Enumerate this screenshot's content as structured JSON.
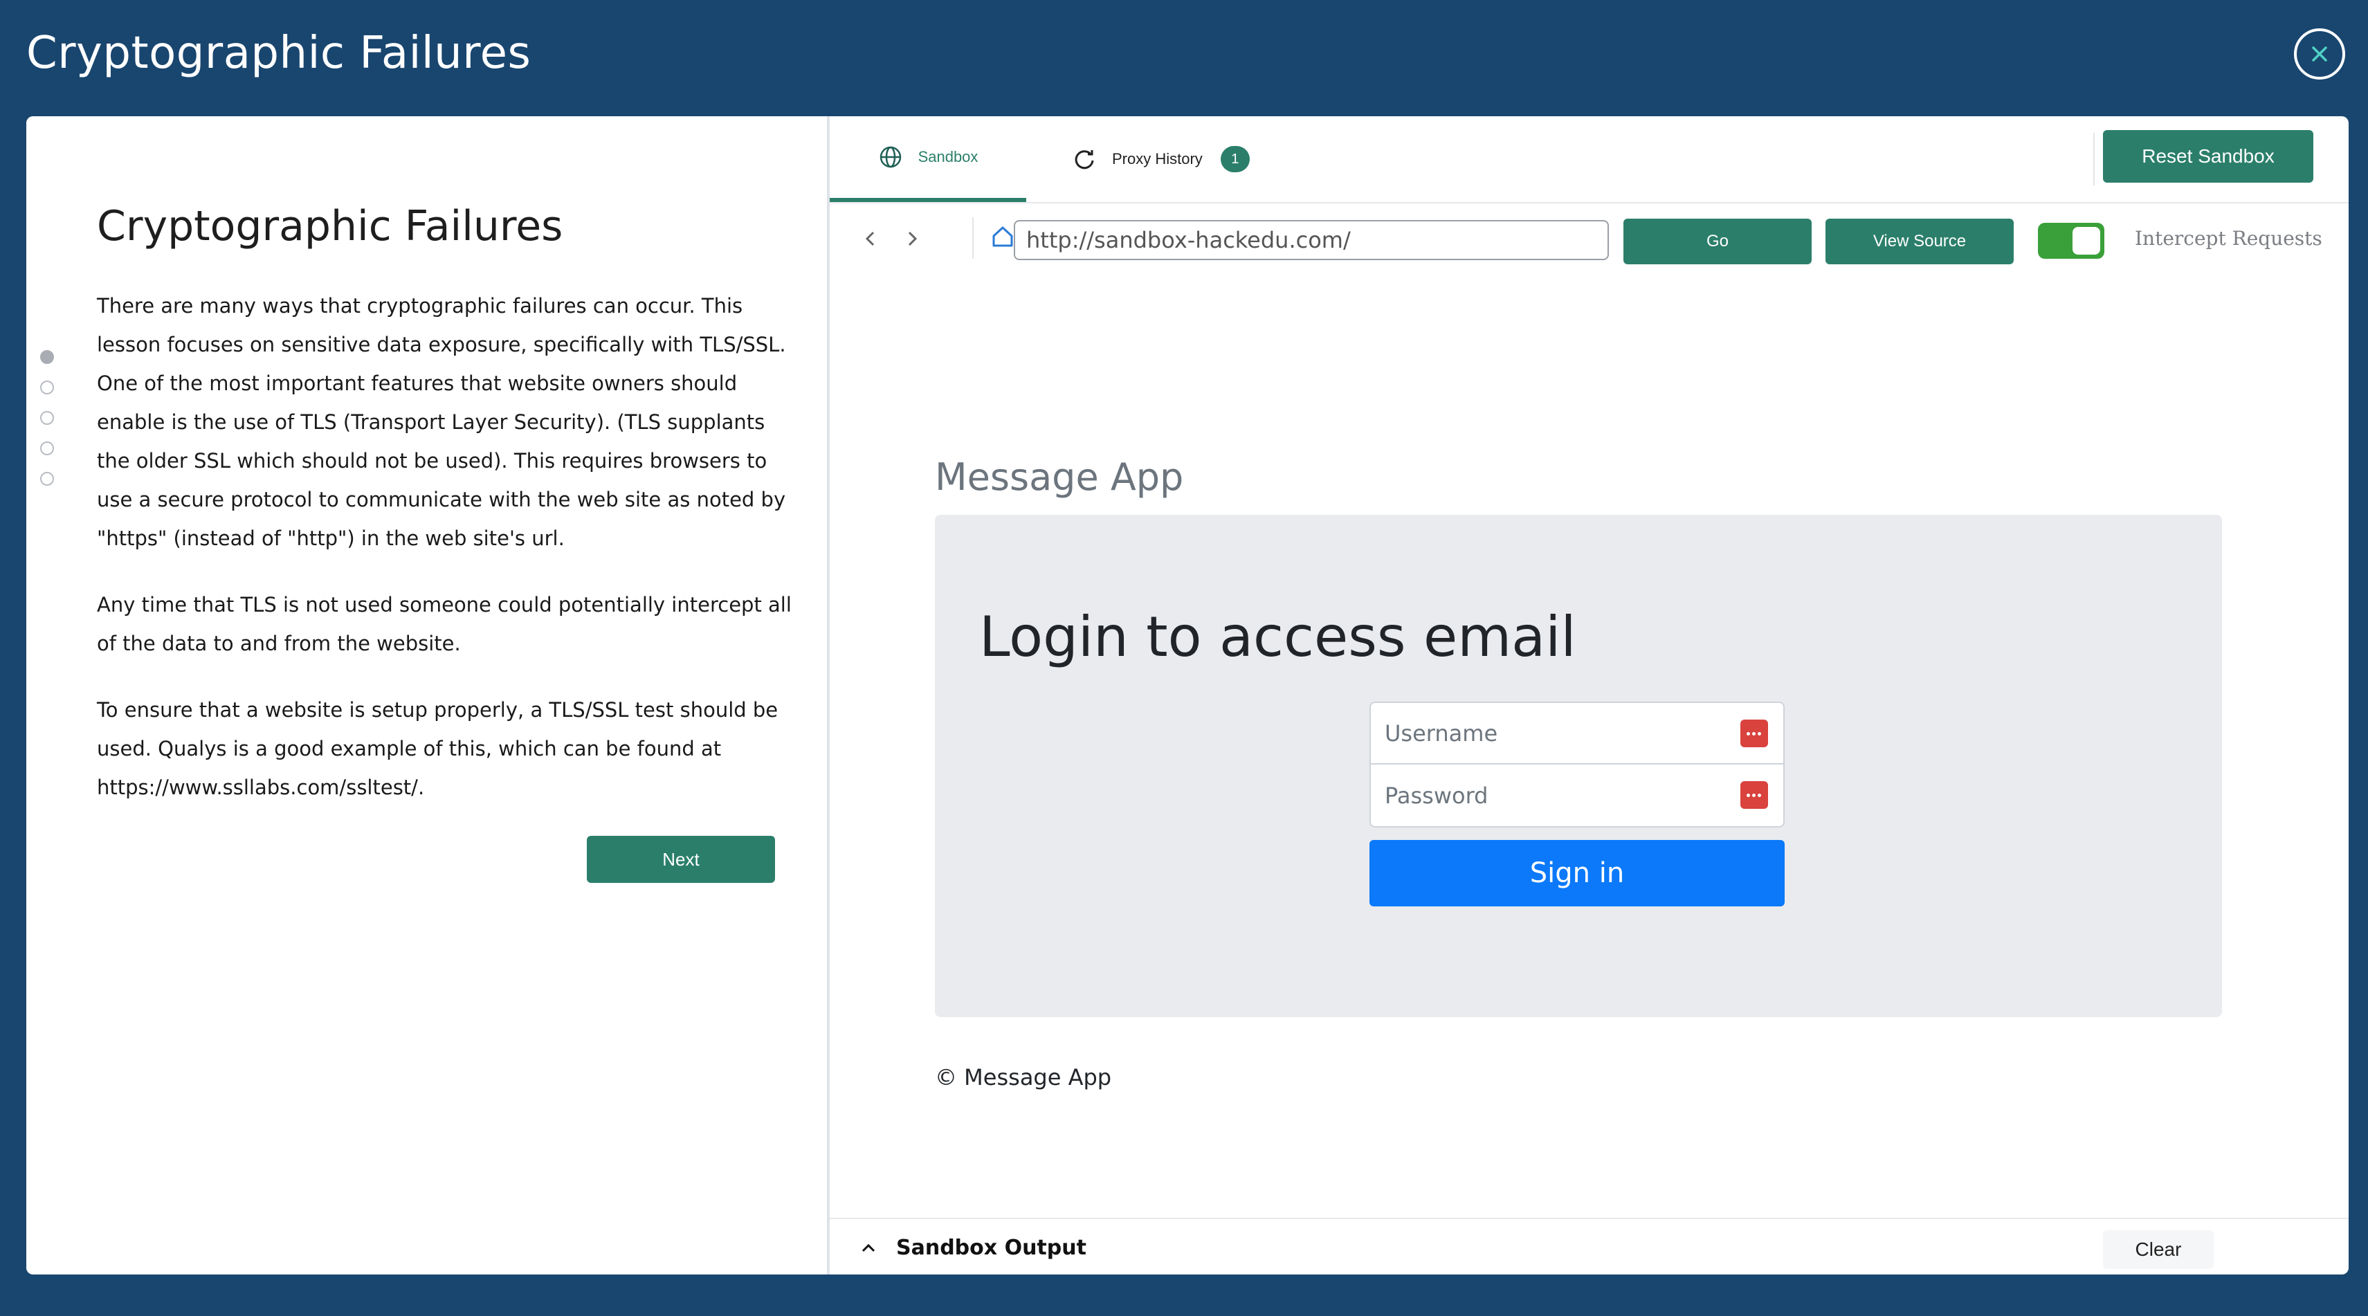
{
  "window": {
    "title": "Cryptographic Failures",
    "close_icon": "close-icon"
  },
  "lesson": {
    "title": "Cryptographic Failures",
    "paragraphs": [
      "There are many ways that cryptographic failures can occur. This lesson focuses on sensitive data exposure, specifically with TLS/SSL. One of the most important features that website owners should enable is the use of TLS (Transport Layer Security). (TLS supplants the older SSL which should not be used). This requires browsers to use a secure protocol to communicate with the web site as noted by \"https\" (instead of \"http\") in the web site's url.",
      "Any time that TLS is not used someone could potentially intercept all of the data to and from the website.",
      "To ensure that a website is setup properly, a TLS/SSL test should be used. Qualys is a good example of this, which can be found at https://www.ssllabs.com/ssltest/."
    ],
    "next_label": "Next",
    "steps_total": 5,
    "current_step": 1
  },
  "tabs": {
    "sandbox_label": "Sandbox",
    "proxy_label": "Proxy History",
    "proxy_count": "1",
    "reset_label": "Reset Sandbox"
  },
  "browser": {
    "url": "http://sandbox-hackedu.com/",
    "go_label": "Go",
    "view_source_label": "View Source",
    "intercept_label": "Intercept Requests",
    "intercept_on": true
  },
  "app": {
    "title": "Message App",
    "heading": "Login to access email",
    "username_placeholder": "Username",
    "password_placeholder": "Password",
    "signin_label": "Sign in",
    "footer": "© Message App"
  },
  "output": {
    "label": "Sandbox Output",
    "clear_label": "Clear"
  },
  "colors": {
    "accent": "#2b7f6a",
    "header_bg": "#19466f",
    "primary_button": "#0b79fa"
  }
}
